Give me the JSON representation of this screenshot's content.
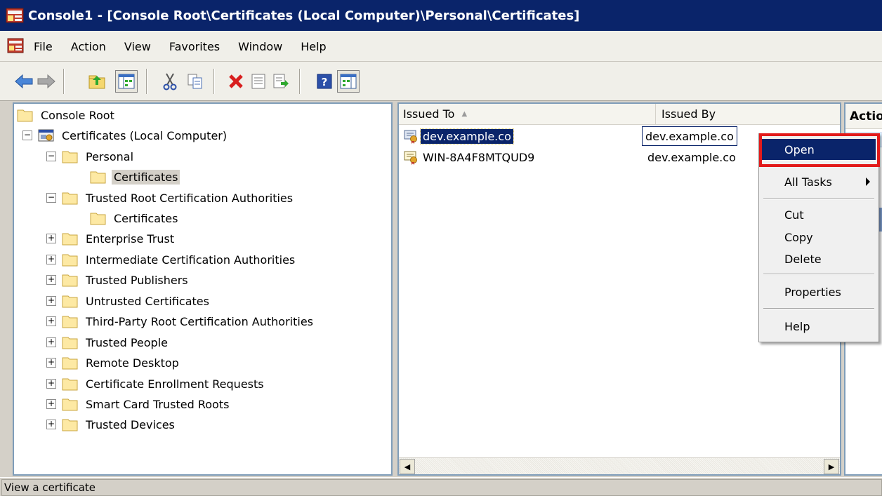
{
  "window": {
    "title": "Console1 - [Console Root\\Certificates (Local Computer)\\Personal\\Certificates]"
  },
  "menubar": {
    "items": [
      "File",
      "Action",
      "View",
      "Favorites",
      "Window",
      "Help"
    ]
  },
  "toolbar": {
    "buttons": [
      "back-arrow-icon",
      "forward-arrow-icon",
      "up-folder-icon",
      "show-hide-tree-icon",
      "cut-icon",
      "copy-icon",
      "delete-icon",
      "properties-icon",
      "export-list-icon",
      "help-icon",
      "show-hide-action-pane-icon"
    ]
  },
  "tree": {
    "root": "Console Root",
    "snapin": "Certificates (Local Computer)",
    "nodes": [
      {
        "label": "Personal",
        "expander": "−"
      },
      {
        "label": "Certificates",
        "expander": ""
      },
      {
        "label": "Trusted Root Certification Authorities",
        "expander": "−"
      },
      {
        "label": "Certificates",
        "expander": ""
      },
      {
        "label": "Enterprise Trust",
        "expander": "+"
      },
      {
        "label": "Intermediate Certification Authorities",
        "expander": "+"
      },
      {
        "label": "Trusted Publishers",
        "expander": "+"
      },
      {
        "label": "Untrusted Certificates",
        "expander": "+"
      },
      {
        "label": "Third-Party Root Certification Authorities",
        "expander": "+"
      },
      {
        "label": "Trusted People",
        "expander": "+"
      },
      {
        "label": "Remote Desktop",
        "expander": "+"
      },
      {
        "label": "Certificate Enrollment Requests",
        "expander": "+"
      },
      {
        "label": "Smart Card Trusted Roots",
        "expander": "+"
      },
      {
        "label": "Trusted Devices",
        "expander": "+"
      }
    ]
  },
  "list": {
    "columns": [
      "Issued To",
      "Issued By"
    ],
    "rows": [
      {
        "issued_to": "dev.example.co",
        "issued_by": "dev.example.co"
      },
      {
        "issued_to": "WIN-8A4F8MTQUD9",
        "issued_by": "dev.example.co"
      }
    ]
  },
  "actions": {
    "header": "Actio"
  },
  "context_menu": {
    "items": [
      "Open",
      "All Tasks",
      "Cut",
      "Copy",
      "Delete",
      "Properties",
      "Help"
    ]
  },
  "status": {
    "text": "View a certificate"
  },
  "colors": {
    "title_bar": "#0a246a",
    "selection": "#0a246a",
    "highlight_box": "#e21a1a",
    "chrome": "#d4d0c8"
  }
}
